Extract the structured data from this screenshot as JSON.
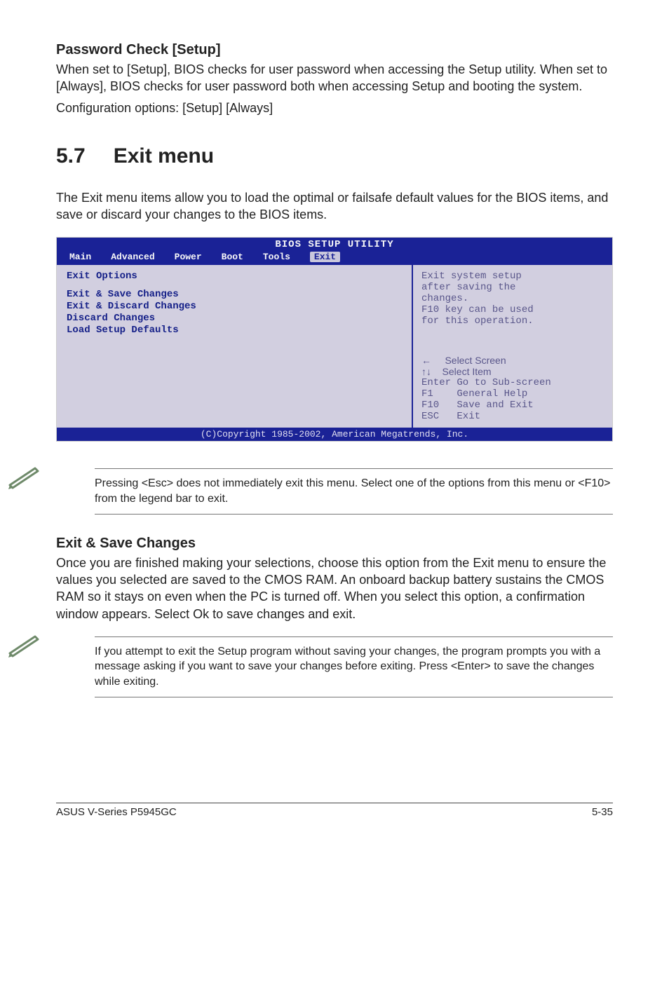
{
  "section1": {
    "title": "Password Check [Setup]",
    "body": "When set to [Setup], BIOS checks for user password when accessing the Setup utility. When set to [Always], BIOS checks for user password both when accessing Setup and booting the system.",
    "config": "Configuration options: [Setup] [Always]"
  },
  "chapter": {
    "num": "5.7",
    "title": "Exit menu"
  },
  "intro": "The Exit menu items allow you to load the optimal or failsafe default values for the BIOS items, and save or discard your changes to the BIOS items.",
  "bios": {
    "app_title": "BIOS SETUP UTILITY",
    "menus": [
      "Main",
      "Advanced",
      "Power",
      "Boot",
      "Tools",
      "Exit"
    ],
    "left_title": "Exit Options",
    "left_items": [
      "Exit & Save Changes",
      "Exit & Discard Changes",
      "Discard Changes",
      "",
      "Load Setup Defaults"
    ],
    "help_lines": [
      "Exit system setup",
      "after saving the",
      "changes.",
      "",
      "F10 key can be used",
      "for this operation."
    ],
    "keys": [
      "←     Select Screen",
      "↑↓    Select Item",
      "Enter Go to Sub-screen",
      "F1    General Help",
      "F10   Save and Exit",
      "ESC   Exit"
    ],
    "copyright": "(C)Copyright 1985-2002, American Megatrends, Inc."
  },
  "note1": "Pressing <Esc> does not immediately exit this menu. Select one of the options from this menu or <F10> from the legend bar to exit.",
  "section2": {
    "title": "Exit & Save Changes",
    "body": "Once you are finished making your selections, choose this option from the Exit menu to ensure the values you selected are saved to the CMOS RAM. An onboard backup battery sustains the CMOS RAM so it stays on even when the PC is turned off. When you select this option, a confirmation window appears. Select Ok to save changes and exit."
  },
  "note2": " If you attempt to exit the Setup program without saving your changes, the program prompts you with a message asking if you want to save your changes before exiting. Press <Enter>  to save the  changes while exiting.",
  "footer": {
    "left": "ASUS V-Series P5945GC",
    "right": "5-35"
  }
}
